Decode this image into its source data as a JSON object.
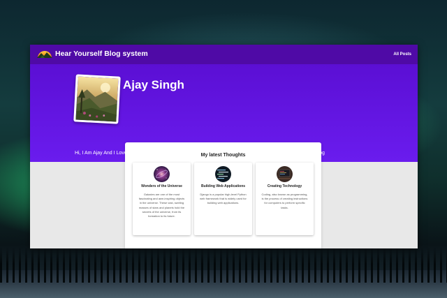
{
  "navbar": {
    "brand": "Hear Yourself Blog system",
    "all_posts_link": "All Posts",
    "logo_icon": "mountain-sunset-logo"
  },
  "profile": {
    "name": "Ajay Singh",
    "bio": "Hi, I Am Ajay And I Love To Blog The All Types Of Things Which Bring Me Closer To Me My All Feelings In This Blog",
    "avatar": "landscape-photo"
  },
  "latest": {
    "heading": "My latest Thoughts",
    "posts": [
      {
        "title": "Wonders of the Universe",
        "description": "Galaxies are one of the most fascinating and awe-inspiring objects in the universe. These vast, swirling masses of stars and planets hold the secrets of the universe, from its formation to its future.",
        "thumbnail": "galaxy-image"
      },
      {
        "title": "Building Web Applications",
        "description": "Django is a popular high-level Python web framework that is widely used for building web applications.",
        "thumbnail": "code-screen-image"
      },
      {
        "title": "Creating Technology",
        "description": "Coding, also known as programming, is the process of creating instructions for computers to perform specific tasks.",
        "thumbnail": "computer-desk-image"
      }
    ]
  },
  "colors": {
    "navbar": "#4f0aa6",
    "hero": "#6a1cee",
    "page_background": "#e8e8e8",
    "text_light": "#ffffff"
  }
}
